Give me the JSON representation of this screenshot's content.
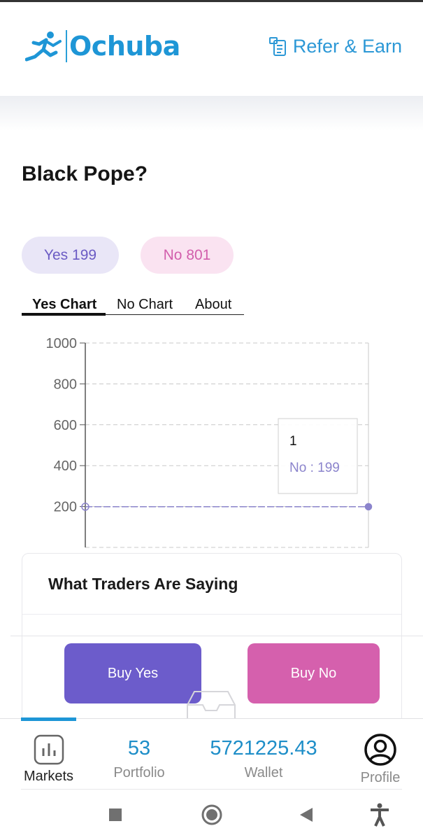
{
  "header": {
    "brand": "Ochuba",
    "refer_label": "Refer & Earn"
  },
  "market": {
    "question": "Black Pope?",
    "yes_label": "Yes 199",
    "no_label": "No 801"
  },
  "tabs": [
    "Yes Chart",
    "No Chart",
    "About"
  ],
  "chart_data": {
    "type": "line",
    "yticks": [
      1000,
      800,
      600,
      400,
      200
    ],
    "ylim": [
      0,
      1000
    ],
    "grid": true,
    "series": [
      {
        "values": [
          199,
          199
        ]
      }
    ],
    "tooltip": {
      "title": "1",
      "text": "No : 199"
    }
  },
  "traders": {
    "title": "What Traders Are Saying"
  },
  "actions": {
    "buy_yes": "Buy Yes",
    "buy_no": "Buy No"
  },
  "nav": {
    "markets": "Markets",
    "portfolio_value": "53",
    "portfolio": "Portfolio",
    "wallet_value": "5721225.43",
    "wallet": "Wallet",
    "profile": "Profile"
  },
  "colors": {
    "brand": "#1e96d6",
    "yes": "#6c5ccb",
    "no": "#d560ad",
    "series": "#8b84cc"
  }
}
